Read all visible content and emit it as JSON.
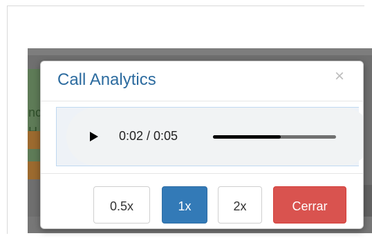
{
  "background": {
    "left_panel_text": "nc\nH"
  },
  "modal": {
    "title": "Call Analytics",
    "close_symbol": "×"
  },
  "player": {
    "time_display": "0:02 / 0:05",
    "progress_fraction": 0.55,
    "play_icon": "play-icon",
    "volume_icon": "volume-icon"
  },
  "footer": {
    "buttons": [
      {
        "label": "0.5x"
      },
      {
        "label": "1x"
      },
      {
        "label": "2x"
      },
      {
        "label": "Cerrar"
      }
    ]
  },
  "colors": {
    "title": "#2c6b9f",
    "primary": "#337ab7",
    "danger": "#d9534f",
    "close": "#bdbdbd"
  }
}
